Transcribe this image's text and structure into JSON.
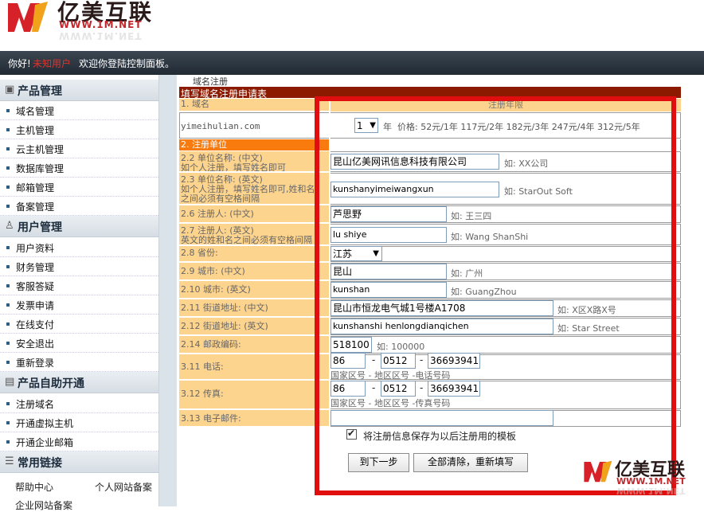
{
  "brand": {
    "logo_text": "亿美互联",
    "url": "WWW.1M.NET",
    "watermark_text": "亿美互联",
    "watermark_url": "WWW.1M.NET"
  },
  "welcome": {
    "hello": "你好!",
    "user": "未知用户",
    "message": "欢迎你登陆控制面板。"
  },
  "sidebar": {
    "sections": [
      {
        "title": "产品管理",
        "icon": "product-icon",
        "items": [
          "域名管理",
          "主机管理",
          "云主机管理",
          "数据库管理",
          "邮箱管理",
          "备案管理"
        ]
      },
      {
        "title": "用户管理",
        "icon": "user-icon",
        "items": [
          "用户资料",
          "财务管理",
          "客服答疑",
          "发票申请",
          "在线支付",
          "安全退出",
          "重新登录"
        ]
      },
      {
        "title": "产品自助开通",
        "icon": "self-service-icon",
        "items": [
          "注册域名",
          "开通虚拟主机",
          "开通企业邮箱"
        ]
      },
      {
        "title": "常用链接",
        "icon": "list-icon",
        "items": []
      }
    ],
    "links": [
      "帮助中心",
      "个人网站备案",
      "企业网站备案"
    ]
  },
  "breadcrumb": "域名注册",
  "form": {
    "title": "填写域名注册申请表",
    "col_domain": "1. 域名",
    "col_period": "注册年限",
    "domain": "yimeihulian.com",
    "years": "1",
    "year_unit": "年",
    "price_text": "价格: 52元/1年 117元/2年 182元/3年 247元/4年 312元/5年",
    "section2": "2. 注册单位",
    "fields": {
      "org_cn": {
        "label": "2.2 单位名称: (中文)\n如个人注册，填写姓名即可",
        "value": "昆山亿美网讯信息科技有限公司",
        "hint": "如: XX公司"
      },
      "org_en": {
        "label": "2.3 单位名称: (英文)\n如个人注册，填写姓名即可,姓和名\n之间必须有空格间隔",
        "value": "kunshanyimeiwangxun",
        "hint": "如: StarOut Soft"
      },
      "reg_cn": {
        "label": "2.6 注册人: (中文)",
        "value": "芦思野",
        "hint": "如: 王三四"
      },
      "reg_en": {
        "label": "2.7 注册人: (英文)\n英文的姓和名之间必须有空格间隔",
        "value": "lu shiye",
        "hint": "如: Wang ShanShi"
      },
      "province": {
        "label": "2.8 省份:",
        "value": "江苏"
      },
      "city_cn": {
        "label": "2.9 城市: (中文)",
        "value": "昆山",
        "hint": "如: 广州"
      },
      "city_en": {
        "label": "2.10 城市: (英文)",
        "value": "kunshan",
        "hint": "如: GuangZhou"
      },
      "addr_cn": {
        "label": "2.11 街道地址: (中文)",
        "value": "昆山市恒龙电气城1号楼A1708",
        "hint": "如: X区X路X号"
      },
      "addr_en": {
        "label": "2.12 街道地址: (英文)",
        "value": "kunshanshi henlongdianqichen",
        "hint": "如: Star Street"
      },
      "zip": {
        "label": "2.14 邮政编码:",
        "value": "518100",
        "hint": "如: 100000"
      },
      "phone": {
        "label": "3.11 电话:",
        "country": "86",
        "area": "0512",
        "number": "36693941",
        "sub": "国家区号 - 地区区号 -电话号码"
      },
      "fax": {
        "label": "3.12 传真:",
        "country": "86",
        "area": "0512",
        "number": "36693941",
        "sub": "国家区号 - 地区区号 -传真号码"
      },
      "email": {
        "label": "3.13 电子邮件:",
        "value": ""
      }
    },
    "dash": "-",
    "save_template_label": "将注册信息保存为以后注册用的模板",
    "next_button": "到下一步",
    "reset_button": "全部清除，重新填写"
  }
}
